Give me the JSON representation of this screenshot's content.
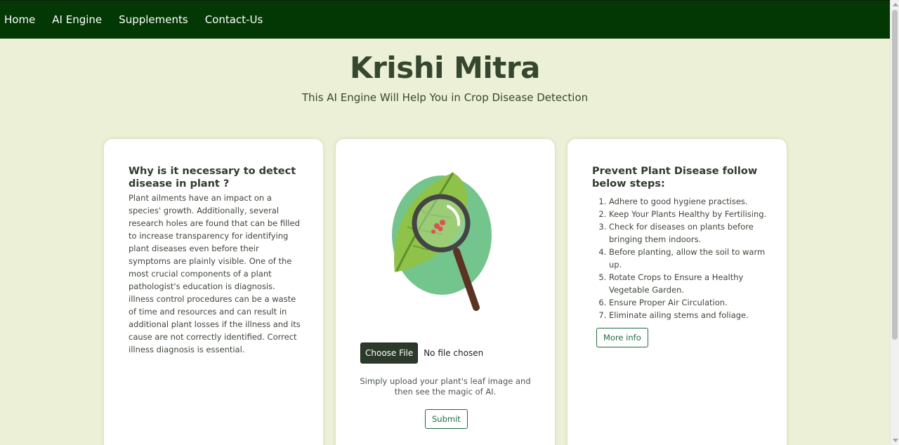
{
  "nav": {
    "items": [
      {
        "label": "Home"
      },
      {
        "label": "AI Engine"
      },
      {
        "label": "Supplements"
      },
      {
        "label": "Contact-Us"
      }
    ]
  },
  "hero": {
    "title": "Krishi Mitra",
    "subtitle": "This AI Engine Will Help You in Crop Disease Detection"
  },
  "why_card": {
    "heading": "Why is it necessary to detect disease in plant ?",
    "body": "Plant ailments have an impact on a species' growth. Additionally, several research holes are found that can be filled to increase transparency for identifying plant diseases even before their symptoms are plainly visible. One of the most crucial components of a plant pathologist's education is diagnosis. illness control procedures can be a waste of time and resources and can result in additional plant losses if the illness and its cause are not correctly identified. Correct illness diagnosis is essential."
  },
  "upload_card": {
    "choose_file_label": "Choose File",
    "file_status": "No file chosen",
    "hint": "Simply upload your plant's leaf image and then see the magic of AI.",
    "submit_label": "Submit"
  },
  "prevent_card": {
    "heading": "Prevent Plant Disease follow below steps:",
    "steps": [
      "Adhere to good hygiene practises.",
      "Keep Your Plants Healthy by Fertilising.",
      "Check for diseases on plants before bringing them indoors.",
      "Before planting, allow the soil to warm up.",
      "Rotate Crops to Ensure a Healthy Vegetable Garden.",
      "Ensure Proper Air Circulation.",
      "Eliminate ailing stems and foliage."
    ],
    "more_info_label": "More info"
  },
  "colors": {
    "navbar": "#033804",
    "page_background": "#ecf0d6",
    "title_text": "#36472f",
    "accent_button": "#1e6b45",
    "choose_file_button": "#2b3a2a"
  },
  "icons": [
    "leaf-icon",
    "magnifier-icon"
  ]
}
